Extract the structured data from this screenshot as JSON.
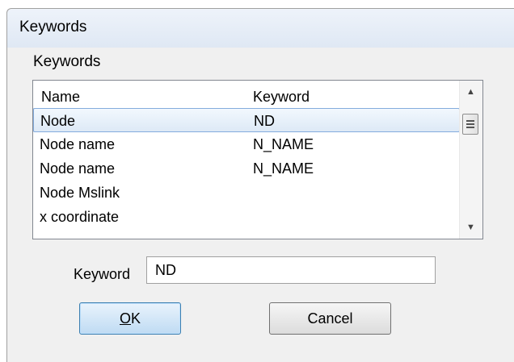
{
  "window": {
    "title": "Keywords"
  },
  "menubar": {
    "items": [
      "Keywords"
    ]
  },
  "list": {
    "columns": [
      "Name",
      "Keyword"
    ],
    "rows": [
      {
        "name": "Node",
        "keyword": "ND",
        "selected": true
      },
      {
        "name": "Node name",
        "keyword": "N_NAME",
        "selected": false
      },
      {
        "name": "Node name",
        "keyword": "N_NAME",
        "selected": false
      },
      {
        "name": "Node Mslink",
        "keyword": "",
        "selected": false
      },
      {
        "name": "x coordinate",
        "keyword": "",
        "selected": false
      }
    ],
    "scroll_up_icon": "triangle-up",
    "scroll_down_icon": "triangle-down"
  },
  "keyword_field": {
    "label": "Keyword",
    "value": "ND"
  },
  "buttons": {
    "ok_mnemonic": "O",
    "ok_rest": "K",
    "cancel_label": "Cancel"
  },
  "colors": {
    "selection_border": "#84acdd",
    "default_button_border": "#3c7fb1"
  }
}
